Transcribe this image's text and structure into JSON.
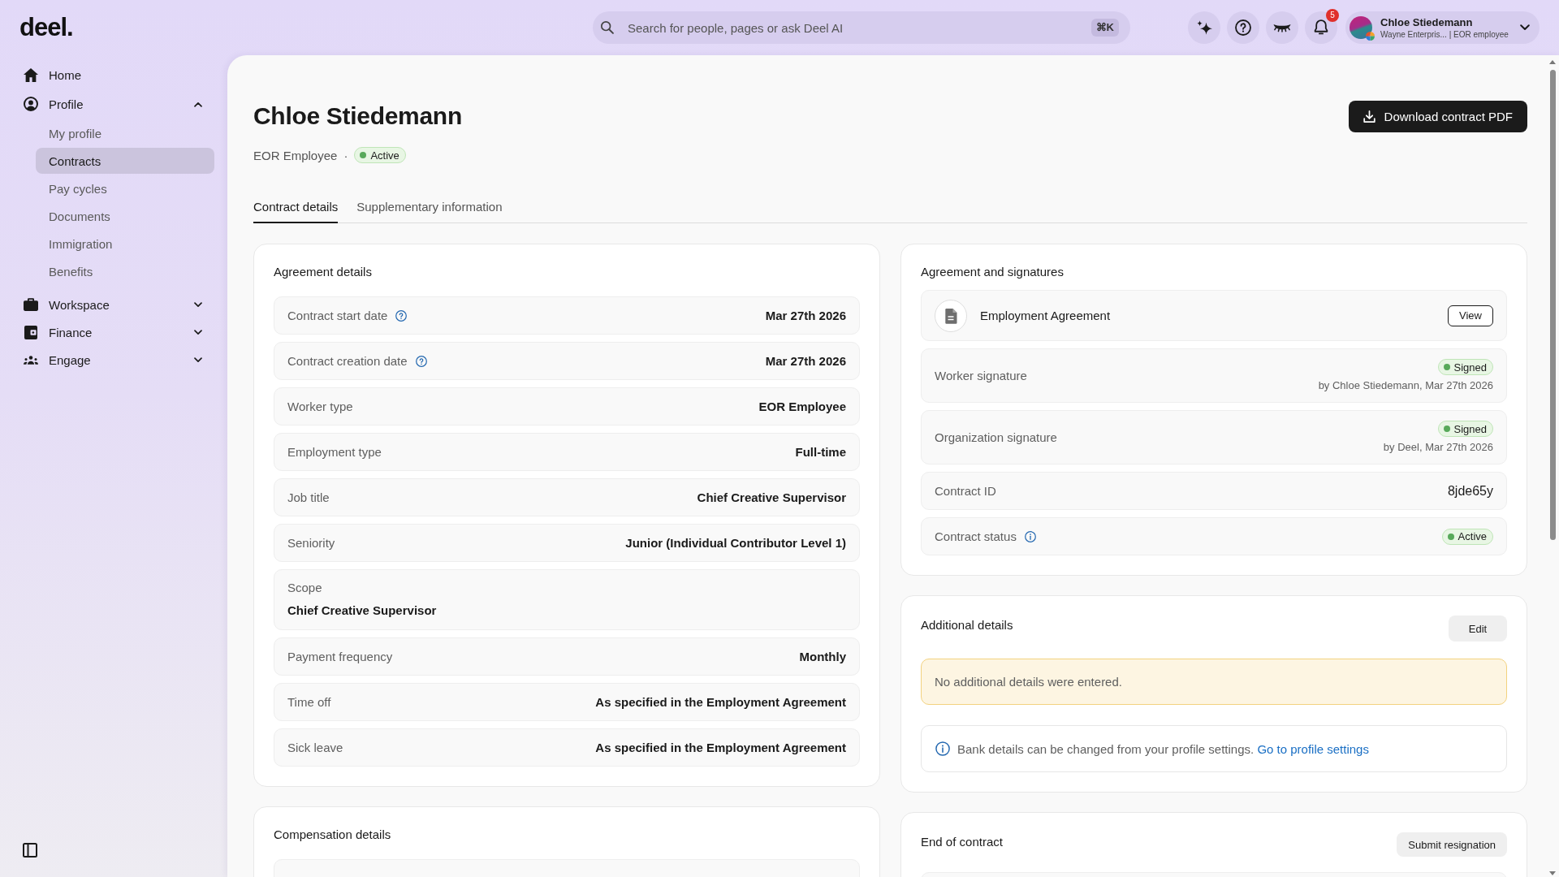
{
  "top_bar": {
    "logo": "deel.",
    "search": {
      "placeholder": "Search for people, pages or ask Deel AI",
      "shortcut": "⌘K"
    },
    "notification_count": "5",
    "user": {
      "name": "Chloe Stiedemann",
      "subtitle": "Wayne Enterpris... | EOR employee"
    }
  },
  "sidebar": {
    "home": {
      "label": "Home"
    },
    "groups": [
      {
        "label": "Profile",
        "expanded": true,
        "children": [
          {
            "label": "My profile",
            "selected": false
          },
          {
            "label": "Contracts",
            "selected": true
          },
          {
            "label": "Pay cycles",
            "selected": false
          },
          {
            "label": "Documents",
            "selected": false
          },
          {
            "label": "Immigration",
            "selected": false
          },
          {
            "label": "Benefits",
            "selected": false
          }
        ]
      },
      {
        "label": "Workspace",
        "expanded": false
      },
      {
        "label": "Finance",
        "expanded": false
      },
      {
        "label": "Engage",
        "expanded": false
      }
    ]
  },
  "header": {
    "title": "Chloe Stiedemann",
    "worker_type": "EOR Employee",
    "separator": "·",
    "status": "Active",
    "download_button": "Download contract PDF"
  },
  "tabs": [
    {
      "label": "Contract details",
      "selected": true
    },
    {
      "label": "Supplementary information",
      "selected": false
    }
  ],
  "agreement_details": {
    "title": "Agreement details",
    "rows": [
      {
        "kind": "inline",
        "label": "Contract start date",
        "value": "Mar 27th 2026",
        "help_icon": true
      },
      {
        "kind": "inline",
        "label": "Contract creation date",
        "value": "Mar 27th 2026",
        "help_icon": true
      },
      {
        "kind": "inline",
        "label": "Worker type",
        "value": "EOR Employee",
        "help_icon": false
      },
      {
        "kind": "inline",
        "label": "Employment type",
        "value": "Full-time",
        "help_icon": false
      },
      {
        "kind": "inline",
        "label": "Job title",
        "value": "Chief Creative Supervisor",
        "help_icon": false
      },
      {
        "kind": "inline",
        "label": "Seniority",
        "value": "Junior (Individual Contributor Level 1)",
        "help_icon": false
      },
      {
        "kind": "stacked",
        "label": "Scope",
        "value": "Chief Creative Supervisor",
        "help_icon": false
      },
      {
        "kind": "inline",
        "label": "Payment frequency",
        "value": "Monthly",
        "help_icon": false
      },
      {
        "kind": "inline",
        "label": "Time off",
        "value": "As specified in the Employment Agreement",
        "help_icon": false
      },
      {
        "kind": "inline",
        "label": "Sick leave",
        "value": "As specified in the Employment Agreement",
        "help_icon": false
      }
    ]
  },
  "agreement_signatures": {
    "title": "Agreement and signatures",
    "document": {
      "name": "Employment Agreement",
      "button": "View"
    },
    "signatures": [
      {
        "label": "Worker signature",
        "status": "Signed",
        "by": "by Chloe Stiedemann, Mar 27th 2026"
      },
      {
        "label": "Organization signature",
        "status": "Signed",
        "by": "by Deel, Mar 27th 2026"
      }
    ],
    "rows": [
      {
        "kind": "text",
        "label": "Contract ID",
        "value": "8jde65y",
        "info_icon": false
      },
      {
        "kind": "badge",
        "label": "Contract status",
        "value": "Active",
        "info_icon": true
      }
    ]
  },
  "additional_details": {
    "title": "Additional details",
    "button": "Edit",
    "notice": "No additional details were entered.",
    "info": {
      "text": "Bank details can be changed from your profile settings.",
      "link": "Go to profile settings"
    }
  },
  "compensation_details": {
    "title": "Compensation details"
  },
  "end_of_contract": {
    "title": "End of contract",
    "button": "Submit resignation"
  }
}
